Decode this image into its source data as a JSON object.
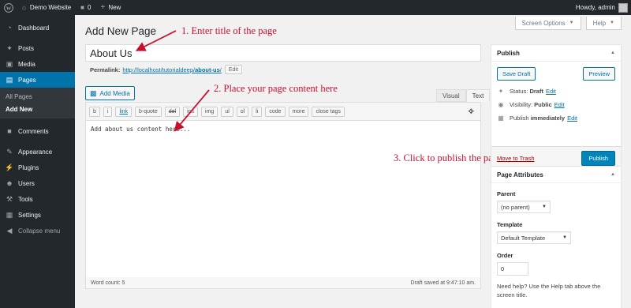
{
  "admin_bar": {
    "site_name": "Demo Website",
    "comments_count": "0",
    "new_label": "New",
    "howdy": "Howdy, admin"
  },
  "sidebar": {
    "items": [
      {
        "label": "Dashboard",
        "icon": "dashboard-icon"
      },
      {
        "label": "Posts",
        "icon": "pin-icon"
      },
      {
        "label": "Media",
        "icon": "media-icon"
      },
      {
        "label": "Pages",
        "icon": "pages-icon"
      },
      {
        "label": "Comments",
        "icon": "comments-icon"
      },
      {
        "label": "Appearance",
        "icon": "brush-icon"
      },
      {
        "label": "Plugins",
        "icon": "plugin-icon"
      },
      {
        "label": "Users",
        "icon": "users-icon"
      },
      {
        "label": "Tools",
        "icon": "wrench-icon"
      },
      {
        "label": "Settings",
        "icon": "settings-icon"
      },
      {
        "label": "Collapse menu",
        "icon": "collapse-icon"
      }
    ],
    "submenu": [
      "All Pages",
      "Add New"
    ]
  },
  "screen_options": "Screen Options",
  "help": "Help",
  "page_title": "Add New Page",
  "post_title_value": "About Us",
  "permalink": {
    "label": "Permalink:",
    "url_prefix": "http://localhost/tutorialdeep/",
    "slug": "about-us",
    "url_suffix": "/",
    "edit": "Edit"
  },
  "add_media": "Add Media",
  "editor_tabs": [
    "Visual",
    "Text"
  ],
  "quicktags": [
    "b",
    "i",
    "link",
    "b-quote",
    "del",
    "ins",
    "img",
    "ul",
    "ol",
    "li",
    "code",
    "more",
    "close tags"
  ],
  "content": "Add about us content here...",
  "word_count": "Word count: 5",
  "draft_saved": "Draft saved at 9:47:10 am.",
  "annotations": {
    "step1": "1. Enter title of the page",
    "step2": "2. Place your page content here",
    "step3": "3. Click to publish the page"
  },
  "publish_box": {
    "title": "Publish",
    "save_draft": "Save Draft",
    "preview": "Preview",
    "status_label": "Status:",
    "status_value": "Draft",
    "visibility_label": "Visibility:",
    "visibility_value": "Public",
    "publish_label": "Publish",
    "publish_value": "immediately",
    "edit": "Edit",
    "move_to_trash": "Move to Trash",
    "publish_button": "Publish"
  },
  "page_attributes": {
    "title": "Page Attributes",
    "parent_label": "Parent",
    "parent_value": "(no parent)",
    "template_label": "Template",
    "template_value": "Default Template",
    "order_label": "Order",
    "order_value": "0",
    "help_text": "Need help? Use the Help tab above the screen title."
  },
  "colors": {
    "accent": "#0073aa",
    "annotation": "#c8102e",
    "sidebar_bg": "#23282d"
  }
}
